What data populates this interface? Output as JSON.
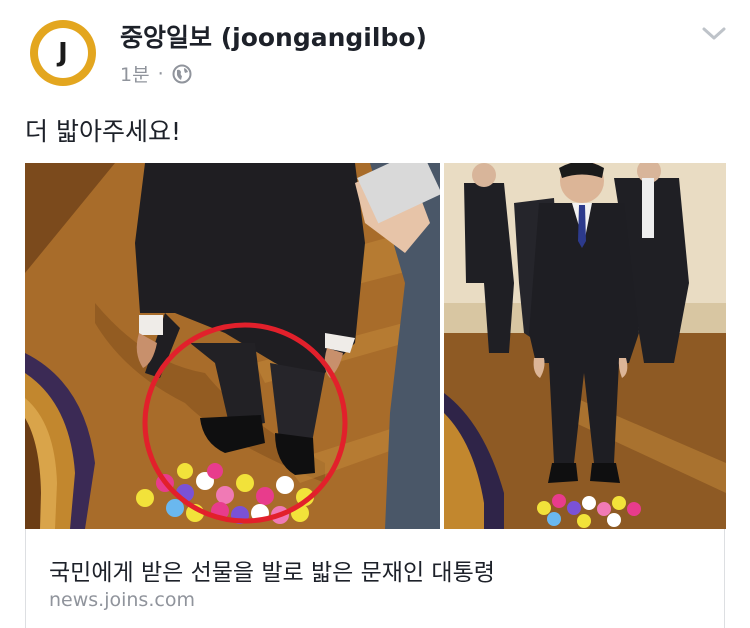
{
  "page": {
    "avatar_letter": "J",
    "name": "중앙일보 (joongangilbo)",
    "time": "1분",
    "separator": "·",
    "privacy_icon": "globe-icon",
    "menu_icon": "chevron-down-icon"
  },
  "post": {
    "text": "더 밟아주세요!"
  },
  "link": {
    "title": "국민에게 받은 선물을 발로 밟은 문재인 대통령",
    "domain": "news.joins.com"
  },
  "colors": {
    "avatar_ring": "#e3a61f",
    "annotation_circle": "#e2202b",
    "meta_text": "#90949c",
    "primary_text": "#1d2129"
  }
}
